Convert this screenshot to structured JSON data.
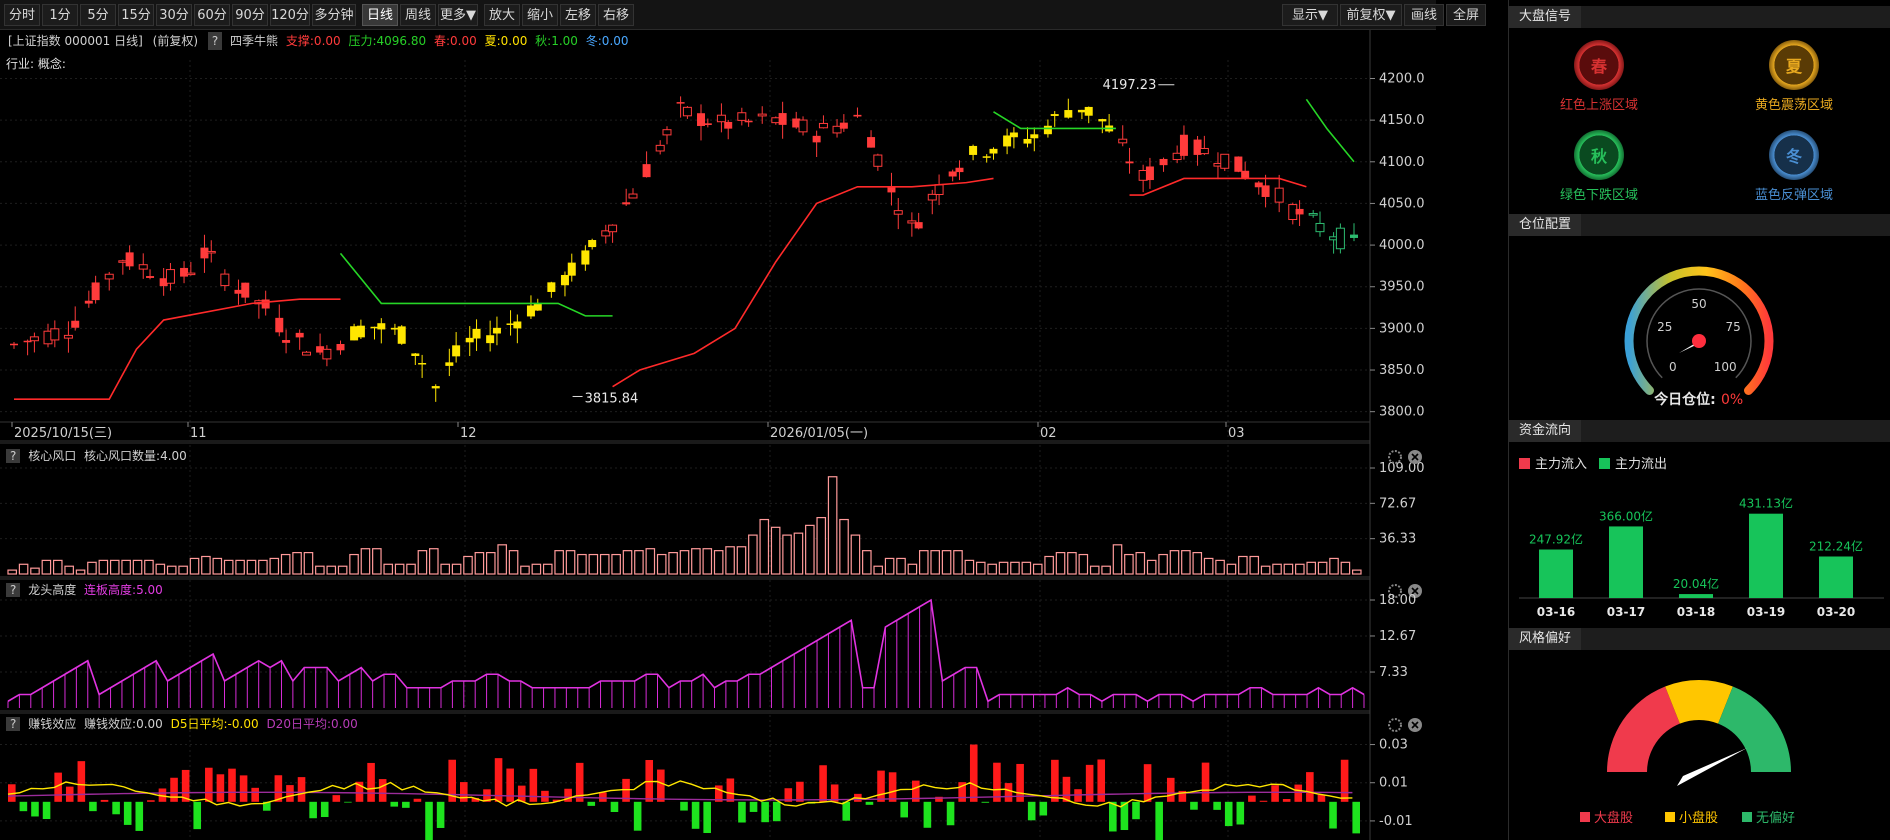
{
  "toolbar": {
    "periods": [
      "分时",
      "1分",
      "5分",
      "15分",
      "30分",
      "60分",
      "90分",
      "120分",
      "多分钟",
      "日线",
      "周线",
      "更多▼",
      "放大",
      "缩小",
      "左移",
      "右移"
    ],
    "active": "日线",
    "right": [
      "显示▼",
      "前复权▼",
      "画线",
      "全屏"
    ]
  },
  "main": {
    "title_prefix": "[上证指数 000001 日线]",
    "adj": "(前复权)",
    "help": "?",
    "indicator": "四季牛熊",
    "support": "支撑:0.00",
    "pressure": "压力:4096.80",
    "spring": "春:0.00",
    "summer": "夏:0.00",
    "autumn": "秋:1.00",
    "winter": "冬:0.00",
    "industry": "行业: 概念:",
    "high_label": "4197.23",
    "low_label": "3815.84",
    "y_ticks": [
      "4200.0",
      "4150.0",
      "4100.0",
      "4050.0",
      "4000.0",
      "3950.0",
      "3900.0",
      "3850.0",
      "3800.0"
    ],
    "x_labels": [
      "2025/10/15(三)",
      "11",
      "12",
      "2026/01/05(一)",
      "02",
      "03"
    ]
  },
  "panel1": {
    "help": "?",
    "name": "核心风口",
    "value_label": "核心风口数量:4.00",
    "y_ticks": [
      "109.00",
      "72.67",
      "36.33"
    ]
  },
  "panel2": {
    "help": "?",
    "name": "龙头高度",
    "value_label": "连板高度:5.00",
    "y_ticks": [
      "18.00",
      "12.67",
      "7.33"
    ]
  },
  "panel3": {
    "help": "?",
    "name": "赚钱效应",
    "value_label": "赚钱效应:0.00",
    "d5": "D5日平均:-0.00",
    "d20": "D20日平均:0.00",
    "y_ticks": [
      "0.03",
      "0.01",
      "-0.01"
    ]
  },
  "right": {
    "signal_header": "大盘信号",
    "signals": [
      {
        "glyph": "春",
        "label": "红色上涨区域",
        "color": "#d83232",
        "ring": "#5a0c0c"
      },
      {
        "glyph": "夏",
        "label": "黄色震荡区域",
        "color": "#e7a81f",
        "ring": "#5a3b05"
      },
      {
        "glyph": "秋",
        "label": "绿色下跌区域",
        "color": "#27c05b",
        "ring": "#0a4a20"
      },
      {
        "glyph": "冬",
        "label": "蓝色反弹区域",
        "color": "#4a8fd3",
        "ring": "#16304a"
      }
    ],
    "position_header": "仓位配置",
    "gauge_ticks": [
      "0",
      "25",
      "50",
      "75",
      "100"
    ],
    "today_label": "今日仓位:",
    "today_value": "0%",
    "flow_header": "资金流向",
    "flow_in": "主力流入",
    "flow_out": "主力流出",
    "flow_bars": [
      {
        "date": "03-16",
        "value": 247.92,
        "label": "247.92亿"
      },
      {
        "date": "03-17",
        "value": 366.0,
        "label": "366.00亿"
      },
      {
        "date": "03-18",
        "value": 20.04,
        "label": "20.04亿"
      },
      {
        "date": "03-19",
        "value": 431.13,
        "label": "431.13亿"
      },
      {
        "date": "03-20",
        "value": 212.24,
        "label": "212.24亿"
      }
    ],
    "style_header": "风格偏好",
    "style_legend": [
      "大盘股",
      "小盘股",
      "无偏好"
    ],
    "colors": {
      "red": "#f03a4c",
      "yellow": "#ffc600",
      "green": "#2db86a"
    }
  },
  "chart_data": [
    {
      "type": "candlestick",
      "title": "上证指数 000001 日线",
      "ylim": [
        3790,
        4215
      ],
      "high": 4197.23,
      "low": 3815.84,
      "regime_note": "candle colors: red=up/春, yellow=夏, green=秋"
    },
    {
      "type": "bar",
      "title": "核心风口",
      "ylim": [
        0,
        109
      ],
      "values": [
        4,
        10,
        6,
        14,
        14,
        8,
        4,
        12,
        14,
        14,
        14,
        14,
        14,
        10,
        8,
        8,
        16,
        18,
        16,
        14,
        14,
        14,
        14,
        16,
        20,
        22,
        22,
        8,
        8,
        8,
        20,
        26,
        26,
        10,
        10,
        10,
        24,
        26,
        10,
        10,
        18,
        22,
        22,
        30,
        24,
        8,
        10,
        10,
        24,
        24,
        20,
        20,
        20,
        20,
        24,
        24,
        26,
        20,
        22,
        24,
        26,
        26,
        24,
        28,
        28,
        40,
        56,
        48,
        40,
        42,
        50,
        58,
        100,
        56,
        40,
        24,
        8,
        16,
        16,
        10,
        24,
        24,
        24,
        24,
        14,
        12,
        10,
        12,
        12,
        12,
        10,
        18,
        22,
        22,
        20,
        8,
        8,
        30,
        20,
        22,
        14,
        20,
        24,
        24,
        22,
        16,
        14,
        10,
        18,
        18,
        8,
        10,
        10,
        10,
        12,
        12,
        16,
        12,
        4
      ]
    },
    {
      "type": "line",
      "title": "龙头高度",
      "ylim": [
        2,
        18
      ],
      "values": [
        3,
        4,
        4,
        5,
        6,
        7,
        8,
        9,
        4,
        5,
        6,
        7,
        8,
        9,
        6,
        7,
        8,
        9,
        10,
        6,
        7,
        8,
        9,
        8,
        9,
        6,
        8,
        8,
        8,
        6,
        7,
        8,
        6,
        7,
        7,
        5,
        5,
        5,
        5,
        6,
        6,
        6,
        7,
        7,
        6,
        6,
        5,
        5,
        5,
        5,
        5,
        5,
        6,
        6,
        6,
        6,
        7,
        7,
        5,
        6,
        6,
        7,
        5,
        6,
        6,
        7,
        7,
        8,
        9,
        10,
        11,
        12,
        13,
        14,
        15,
        5,
        5,
        14,
        15,
        16,
        17,
        18,
        6,
        7,
        8,
        8,
        3,
        4,
        4,
        4,
        4,
        4,
        4,
        5,
        4,
        4,
        3,
        4,
        4,
        4,
        3,
        4,
        4,
        4,
        3,
        4,
        4,
        4,
        4,
        5,
        5,
        4,
        4,
        4,
        4,
        5,
        4,
        4,
        5,
        4
      ]
    },
    {
      "type": "bar",
      "title": "赚钱效应",
      "ylim": [
        -0.02,
        0.035
      ],
      "series": [
        {
          "name": "D5日平均"
        },
        {
          "name": "D20日平均"
        }
      ]
    }
  ]
}
